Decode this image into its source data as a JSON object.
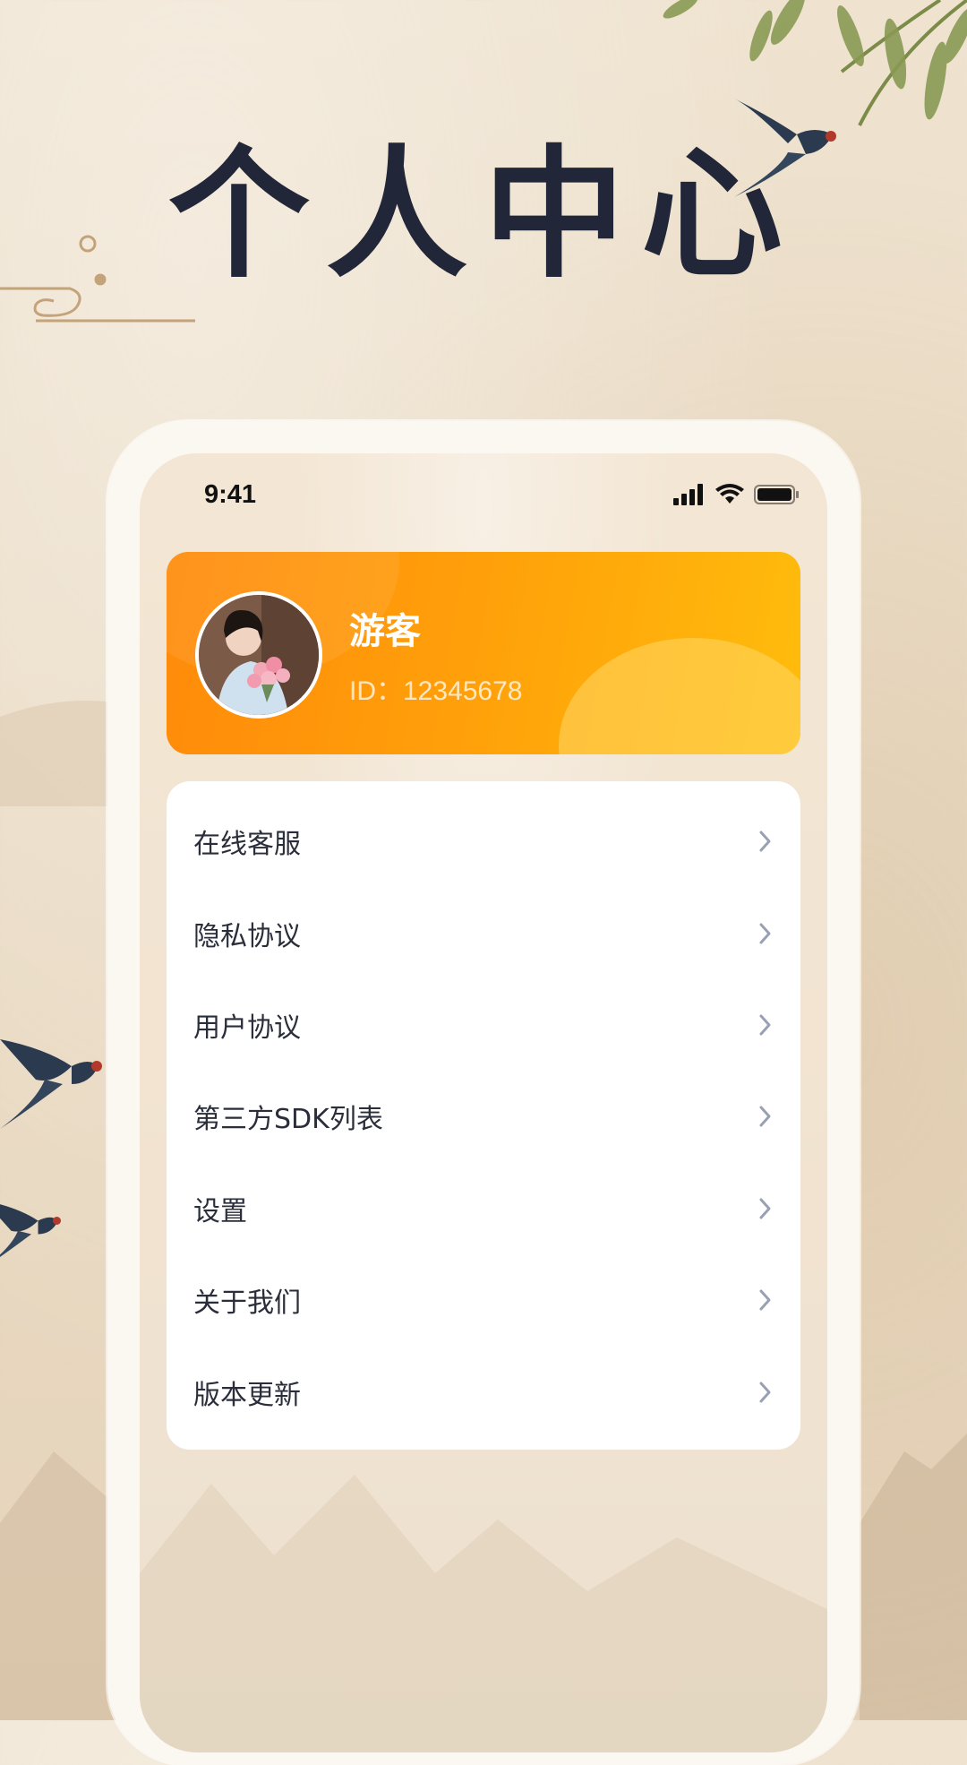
{
  "page": {
    "title": "个人中心"
  },
  "status_bar": {
    "time": "9:41"
  },
  "profile": {
    "name": "游客",
    "id_text": "ID：12345678"
  },
  "menu": {
    "items": [
      {
        "label": "在线客服"
      },
      {
        "label": "隐私协议"
      },
      {
        "label": "用户协议"
      },
      {
        "label": "第三方SDK列表"
      },
      {
        "label": "设置"
      },
      {
        "label": "关于我们"
      },
      {
        "label": "版本更新"
      }
    ]
  },
  "colors": {
    "title": "#222639",
    "accent_start": "#ff8a0a",
    "accent_end": "#ffbc0c",
    "menu_text": "#2a2d3a",
    "chevron": "#9aa0b4"
  },
  "icons": [
    "signal-icon",
    "wifi-icon",
    "battery-icon",
    "chevron-right-icon",
    "swallow-icon",
    "willow-icon"
  ]
}
